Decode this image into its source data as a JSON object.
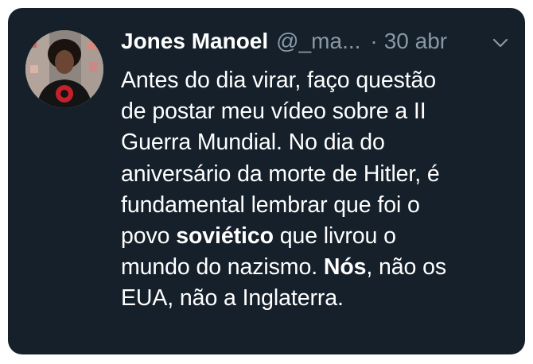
{
  "tweet": {
    "author_name": "Jones Manoel",
    "handle": "@_ma...",
    "separator": "·",
    "date": "30 abr",
    "body": {
      "l1": "Antes do dia virar, faço questão",
      "l2": "de postar meu vídeo sobre a II",
      "l3": "Guerra Mundial. No dia do",
      "l4": "aniversário da morte de Hitler, é",
      "l5": "fundamental lembrar que foi o",
      "l6a": "povo ",
      "l6b": "soviético",
      "l6c": " que livrou o",
      "l7a": "mundo do nazismo. ",
      "l7b": "Nós",
      "l7c": ", não os",
      "l8": "EUA, não a Inglaterra."
    }
  },
  "icons": {
    "avatar": "profile-photo",
    "menu": "chevron-down-icon"
  },
  "colors": {
    "background": "#15202b",
    "text": "#ffffff",
    "muted": "#8899a6"
  }
}
